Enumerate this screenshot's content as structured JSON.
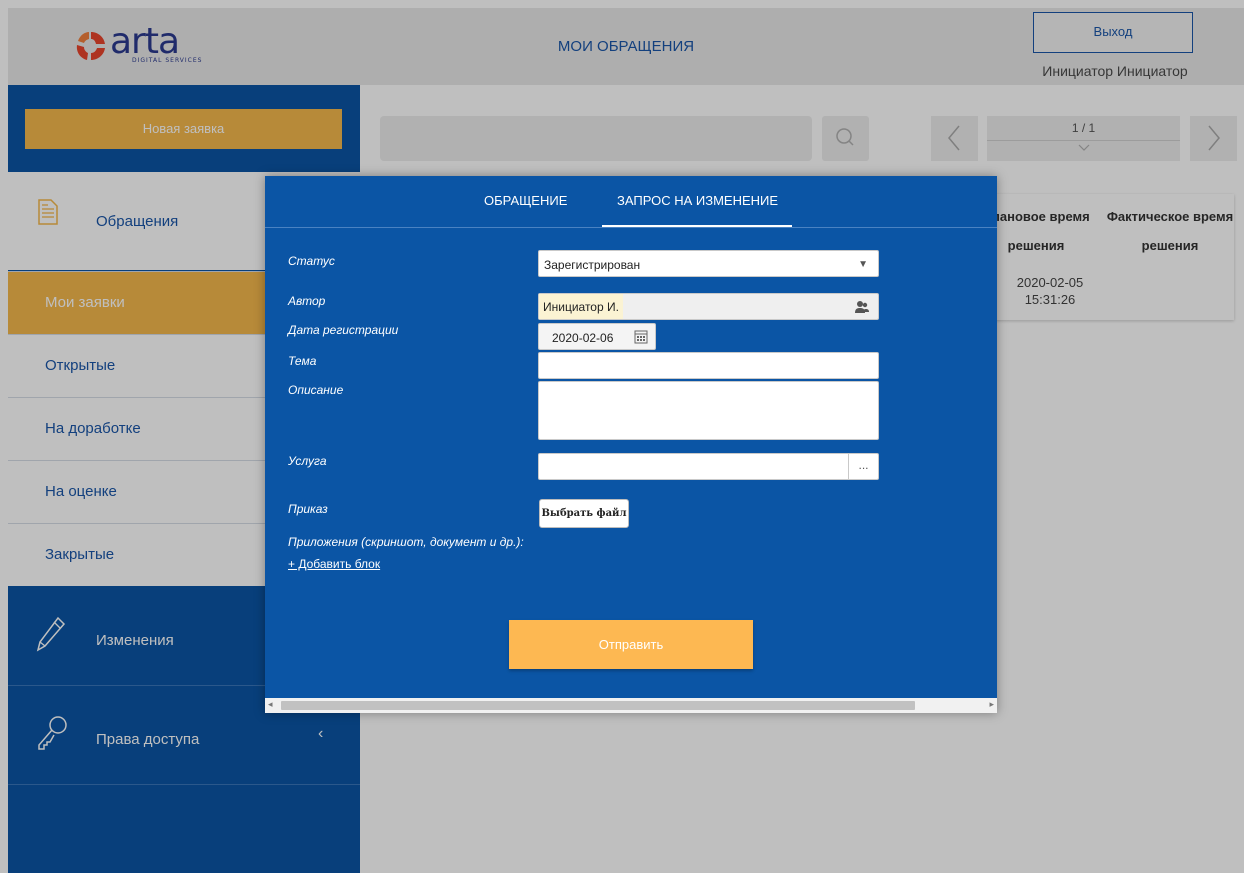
{
  "header": {
    "logo_text": "arta",
    "logo_subtitle": "DIGITAL SERVICES",
    "page_title": "МОИ ОБРАЩЕНИЯ",
    "logout_label": "Выход",
    "user_name": "Инициатор Инициатор"
  },
  "sidebar": {
    "new_request_label": "Новая заявка",
    "requests_section": {
      "label": "Обращения",
      "icon": "document-icon"
    },
    "items": [
      {
        "label": "Мои заявки",
        "active": true
      },
      {
        "label": "Открытые"
      },
      {
        "label": "На доработке"
      },
      {
        "label": "На оценке"
      },
      {
        "label": "Закрытые"
      }
    ],
    "changes_section": {
      "label": "Изменения",
      "icon": "pencil-icon"
    },
    "access_section": {
      "label": "Права доступа",
      "icon": "key-icon"
    }
  },
  "main": {
    "search_placeholder": "",
    "pager_text": "1 / 1",
    "table": {
      "headers": [
        "Плановое время решения",
        "Фактическое время решения"
      ],
      "rows": [
        {
          "planned": "2020-02-05 15:31:26",
          "actual": ""
        }
      ]
    }
  },
  "modal": {
    "tabs": [
      "ОБРАЩЕНИЕ",
      "ЗАПРОС НА ИЗМЕНЕНИЕ"
    ],
    "active_tab": "ЗАПРОС НА ИЗМЕНЕНИЕ",
    "fields": {
      "status_label": "Статус",
      "status_value": "Зарегистрирован",
      "author_label": "Автор",
      "author_value": "Инициатор И.",
      "reg_date_label": "Дата регистрации",
      "reg_date_value": "2020-02-06",
      "topic_label": "Тема",
      "topic_value": "",
      "description_label": "Описание",
      "description_value": "",
      "service_label": "Услуга",
      "service_value": "",
      "service_button": "...",
      "order_label": "Приказ",
      "choose_file_label": "Выбрать файл",
      "attachments_label": "Приложения (скриншот, документ и др.):",
      "add_block_label": "+ Добавить блок"
    },
    "submit_label": "Отправить"
  },
  "colors": {
    "primary_blue": "#0b55a5",
    "accent_orange": "#f5b84d",
    "link_blue": "#1a56a8",
    "submit_orange": "#fdb852"
  }
}
